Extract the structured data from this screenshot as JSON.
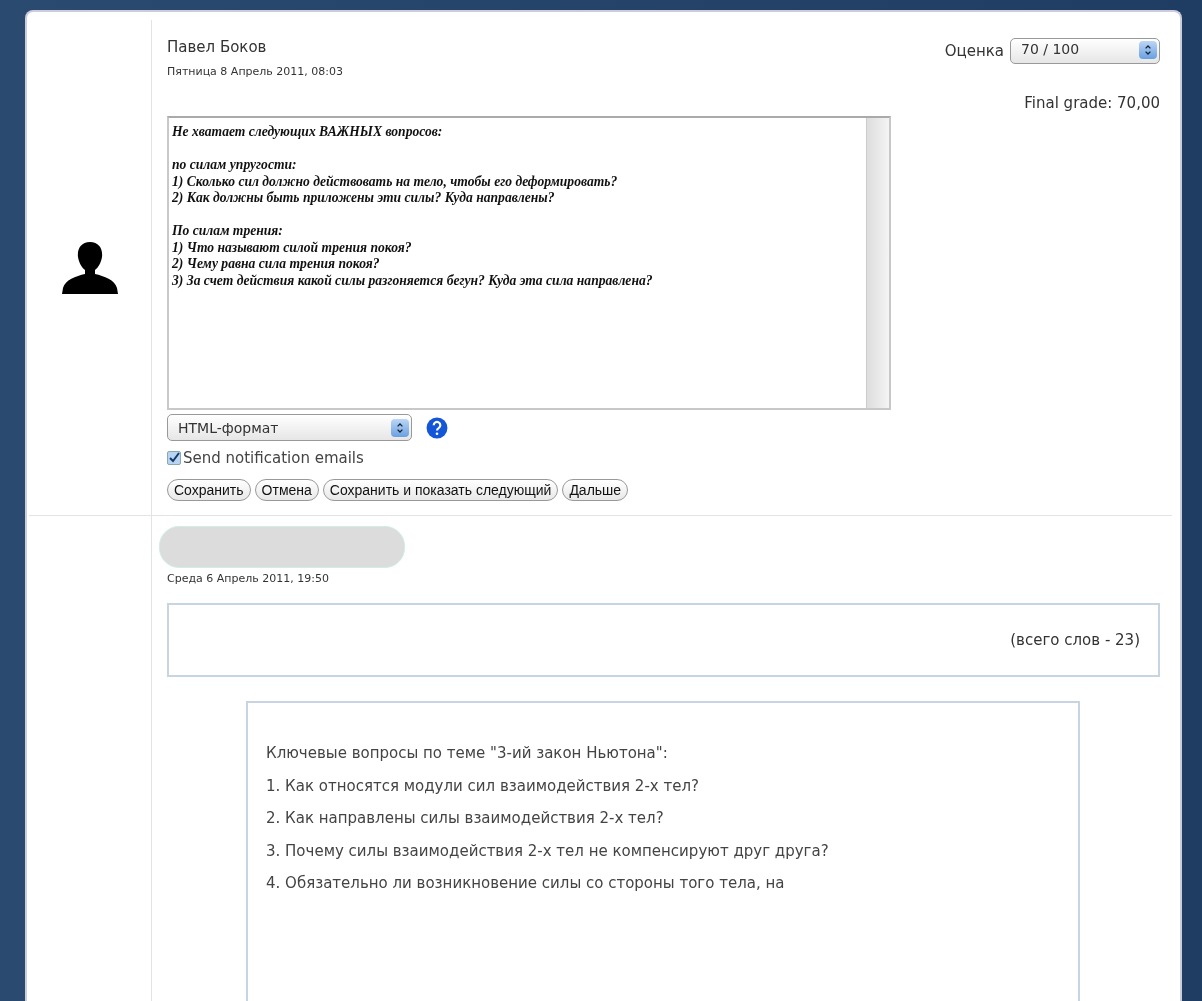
{
  "entries": [
    {
      "kind": "grading",
      "author": "Павел Боков",
      "date": "Пятница 8 Апрель 2011, 08:03",
      "grade": {
        "label": "Оценка",
        "value": "70 / 100"
      },
      "final_grade": "Final grade: 70,00",
      "feedback": "Не хватает следующих ВАЖНЫХ вопросов:\n\nпо силам упругости:\n1) Сколько сил должно действовать на тело, чтобы его деформировать?\n2) Как должны быть приложены эти силы? Куда направлены?\n\nПо силам трения:\n1) Что называют силой трения покоя?\n2) Чему равна сила трения покоя?\n3) За счет действия какой силы разгоняется бегун? Куда эта сила направлена?",
      "format": "HTML-формат",
      "notify": {
        "label": "Send notification emails",
        "checked": true
      },
      "buttons": [
        "Сохранить",
        "Отмена",
        "Сохранить и показать следующий",
        "Дальше"
      ]
    },
    {
      "kind": "submission",
      "date": "Среда 6 Апрель 2011, 19:50",
      "word_count": "(всего слов - 23)",
      "lines": [
        "Ключевые вопросы по теме \"3-ий закон Ньютона\":",
        "1. Как относятся модули сил взаимодействия 2-х тел?",
        "2. Как направлены силы взаимодействия 2-х тел?",
        "3. Почему силы взаимодействия 2-х тел не компенсируют друг друга?",
        "4. Обязательно ли возникновение силы со стороны того тела, на"
      ]
    }
  ]
}
